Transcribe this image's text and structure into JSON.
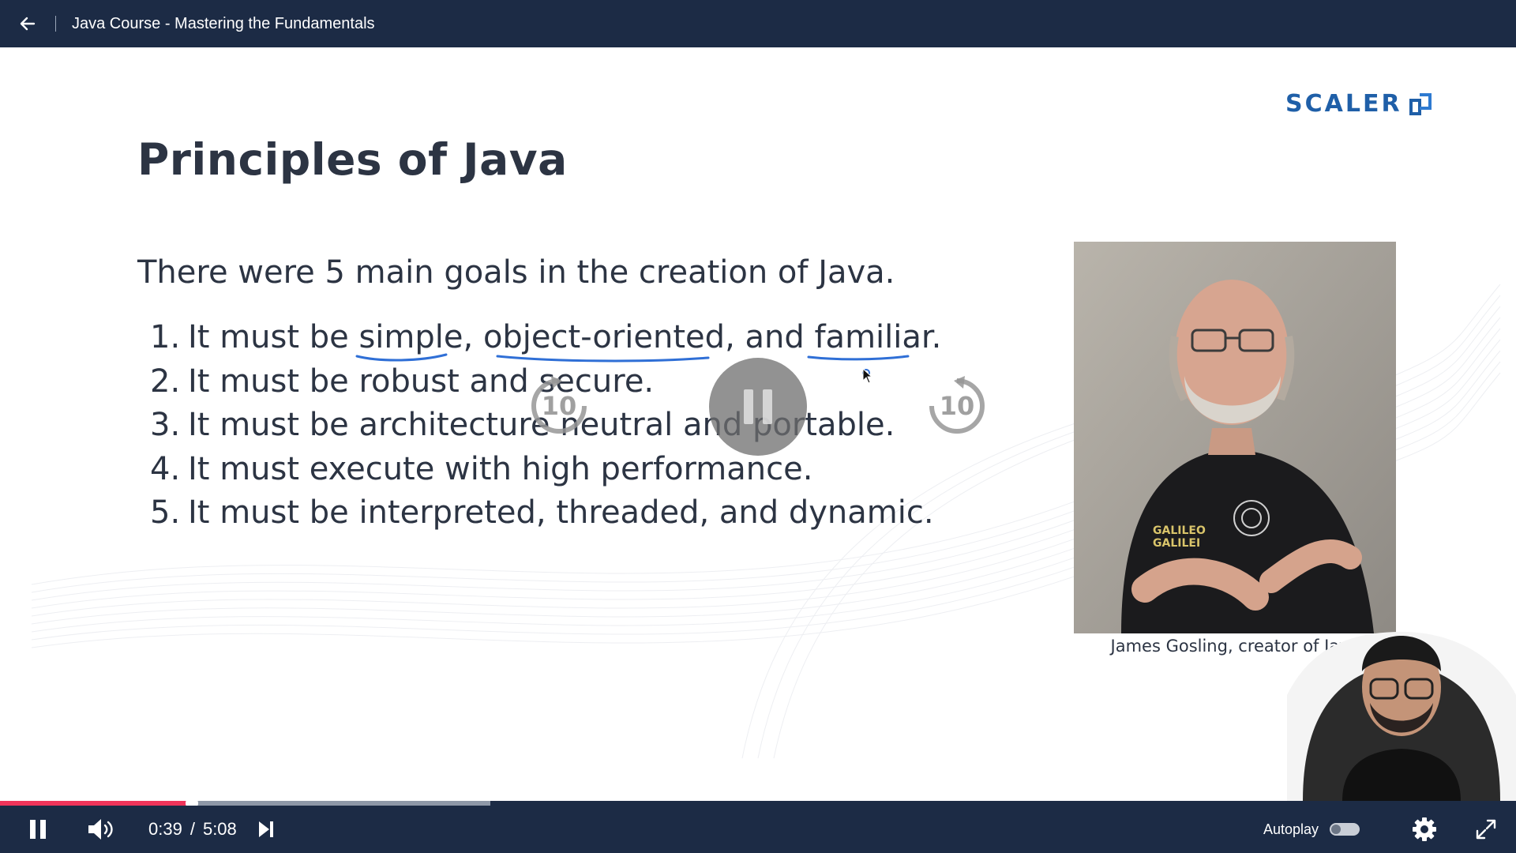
{
  "header": {
    "course_title": "Java Course - Mastering the Fundamentals"
  },
  "slide": {
    "logo_text": "SCALER",
    "title": "Principles of Java",
    "intro": "There were 5 main goals in the creation of Java.",
    "goals": [
      {
        "num": "1.",
        "parts": [
          "It must be ",
          "simple",
          ", ",
          "object-oriented",
          ", and ",
          "familiar",
          "."
        ]
      },
      {
        "num": "2.",
        "text": "It must be robust and secure."
      },
      {
        "num": "3.",
        "text": "It must be architecture neutral and portable."
      },
      {
        "num": "4.",
        "text": "It must execute with high performance."
      },
      {
        "num": "5.",
        "text": "It must be interpreted, threaded, and dynamic."
      }
    ],
    "photo_caption": "James Gosling, creator of Java",
    "shirt_text": "GALILEO GALILEI"
  },
  "overlay": {
    "rewind_seconds": "10",
    "forward_seconds": "10"
  },
  "player": {
    "current_time": "0:39",
    "time_separator": "/",
    "duration": "5:08",
    "progress_fraction": 0.1266,
    "buffered_fraction": 0.3234,
    "autoplay_label": "Autoplay",
    "autoplay_on": false
  },
  "icons": {
    "back": "arrow-left-icon",
    "pause": "pause-icon",
    "volume": "volume-icon",
    "next": "skip-next-icon",
    "settings": "gear-icon",
    "fullscreen": "expand-icon"
  },
  "colors": {
    "bar_background": "#1c2b45",
    "progress_played": "#f0345a",
    "logo_blue": "#1f5fa8",
    "underline_blue": "#2f6fd6"
  }
}
